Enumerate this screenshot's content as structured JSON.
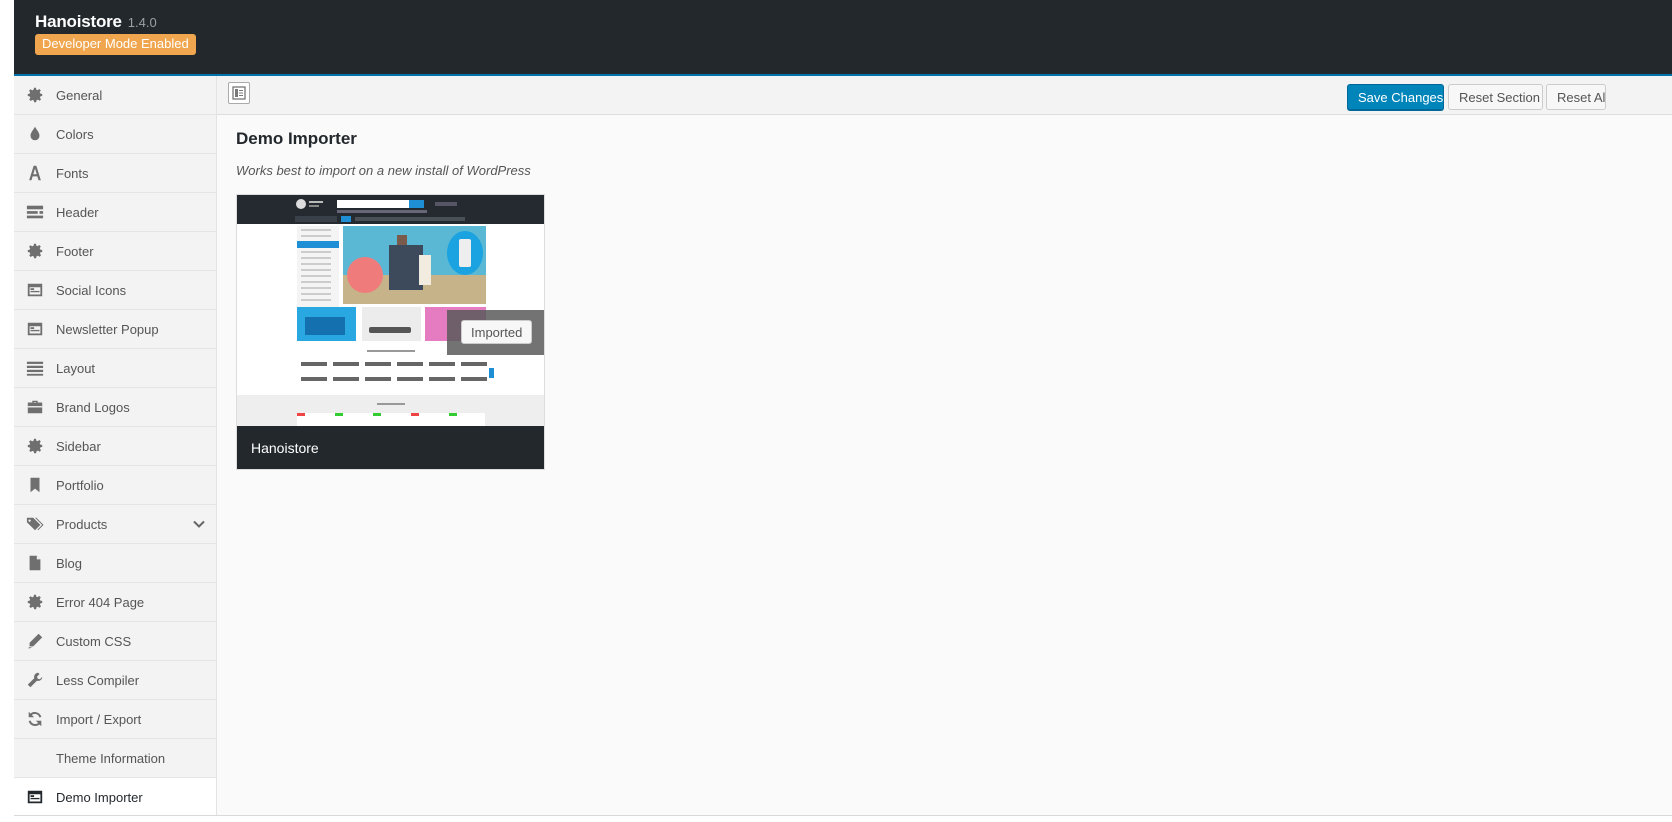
{
  "header": {
    "app_name": "Hanoistore",
    "version": "1.4.0",
    "dev_badge": "Developer Mode Enabled"
  },
  "sidebar": {
    "items": [
      {
        "label": "General",
        "icon": "gear-icon"
      },
      {
        "label": "Colors",
        "icon": "drop-icon"
      },
      {
        "label": "Fonts",
        "icon": "font-icon"
      },
      {
        "label": "Header",
        "icon": "header-icon"
      },
      {
        "label": "Footer",
        "icon": "gear-icon"
      },
      {
        "label": "Social Icons",
        "icon": "window-icon"
      },
      {
        "label": "Newsletter Popup",
        "icon": "window-icon"
      },
      {
        "label": "Layout",
        "icon": "lines-icon"
      },
      {
        "label": "Brand Logos",
        "icon": "briefcase-icon"
      },
      {
        "label": "Sidebar",
        "icon": "gear-icon"
      },
      {
        "label": "Portfolio",
        "icon": "bookmark-icon"
      },
      {
        "label": "Products",
        "icon": "tags-icon",
        "expandable": true
      },
      {
        "label": "Blog",
        "icon": "file-icon"
      },
      {
        "label": "Error 404 Page",
        "icon": "gear-icon"
      },
      {
        "label": "Custom CSS",
        "icon": "pencil-icon"
      },
      {
        "label": "Less Compiler",
        "icon": "wrench-icon"
      },
      {
        "label": "Import / Export",
        "icon": "refresh-icon"
      },
      {
        "label": "Theme Information",
        "icon": ""
      },
      {
        "label": "Demo Importer",
        "icon": "window-icon",
        "active": true
      }
    ]
  },
  "toolbar": {
    "save_label": "Save Changes",
    "reset_section_label": "Reset Section",
    "reset_all_label": "Reset All"
  },
  "section": {
    "title": "Demo Importer",
    "description": "Works best to import on a new install of WordPress"
  },
  "demo": {
    "name": "Hanoistore",
    "status": "Imported"
  },
  "colors": {
    "header_bg": "#23282d",
    "accent": "#0085ba",
    "badge": "#f0a64e"
  }
}
